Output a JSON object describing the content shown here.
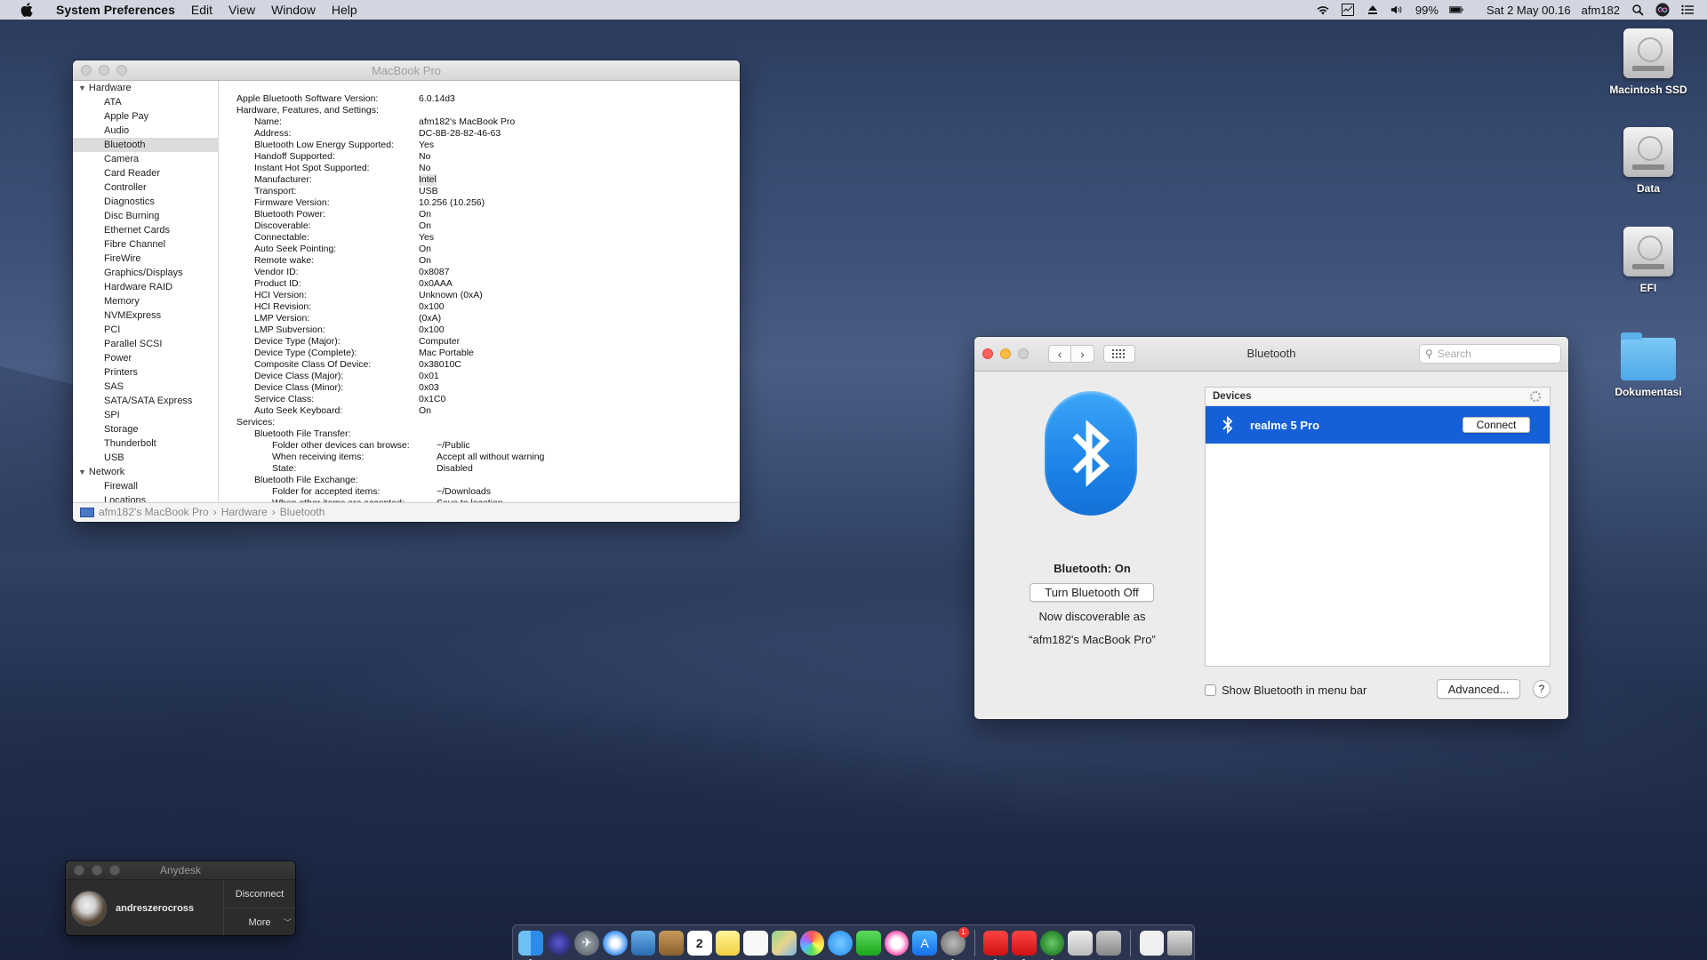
{
  "menubar": {
    "app_name": "System Preferences",
    "menus": [
      "Edit",
      "View",
      "Window",
      "Help"
    ],
    "battery": "99%",
    "datetime": "Sat 2 May  00.16",
    "user": "afm182"
  },
  "sysinfo": {
    "title": "MacBook Pro",
    "sidebar": {
      "hardware_label": "Hardware",
      "hardware_items": [
        "ATA",
        "Apple Pay",
        "Audio",
        "Bluetooth",
        "Camera",
        "Card Reader",
        "Controller",
        "Diagnostics",
        "Disc Burning",
        "Ethernet Cards",
        "Fibre Channel",
        "FireWire",
        "Graphics/Displays",
        "Hardware RAID",
        "Memory",
        "NVMExpress",
        "PCI",
        "Parallel SCSI",
        "Power",
        "Printers",
        "SAS",
        "SATA/SATA Express",
        "SPI",
        "Storage",
        "Thunderbolt",
        "USB"
      ],
      "network_label": "Network",
      "network_items": [
        "Firewall",
        "Locations"
      ]
    },
    "rows": [
      {
        "level": 0,
        "k": "Apple Bluetooth Software Version:",
        "v": "6.0.14d3"
      },
      {
        "level": 0,
        "k": "Hardware, Features, and Settings:",
        "v": ""
      },
      {
        "level": 1,
        "k": "Name:",
        "v": "afm182's MacBook Pro"
      },
      {
        "level": 1,
        "k": "Address:",
        "v": "DC-8B-28-82-46-63"
      },
      {
        "level": 1,
        "k": "Bluetooth Low Energy Supported:",
        "v": "Yes"
      },
      {
        "level": 1,
        "k": "Handoff Supported:",
        "v": "No"
      },
      {
        "level": 1,
        "k": "Instant Hot Spot Supported:",
        "v": "No"
      },
      {
        "level": 1,
        "k": "Manufacturer:",
        "v": "Intel"
      },
      {
        "level": 1,
        "k": "Transport:",
        "v": "USB"
      },
      {
        "level": 1,
        "k": "Firmware Version:",
        "v": "10.256 (10.256)"
      },
      {
        "level": 1,
        "k": "Bluetooth Power:",
        "v": "On"
      },
      {
        "level": 1,
        "k": "Discoverable:",
        "v": "On"
      },
      {
        "level": 1,
        "k": "Connectable:",
        "v": "Yes"
      },
      {
        "level": 1,
        "k": "Auto Seek Pointing:",
        "v": "On"
      },
      {
        "level": 1,
        "k": "Remote wake:",
        "v": "On"
      },
      {
        "level": 1,
        "k": "Vendor ID:",
        "v": "0x8087"
      },
      {
        "level": 1,
        "k": "Product ID:",
        "v": "0x0AAA"
      },
      {
        "level": 1,
        "k": "HCI Version:",
        "v": "Unknown (0xA)"
      },
      {
        "level": 1,
        "k": "HCI Revision:",
        "v": "0x100"
      },
      {
        "level": 1,
        "k": "LMP Version:",
        "v": " (0xA)"
      },
      {
        "level": 1,
        "k": "LMP Subversion:",
        "v": "0x100"
      },
      {
        "level": 1,
        "k": "Device Type (Major):",
        "v": "Computer"
      },
      {
        "level": 1,
        "k": "Device Type (Complete):",
        "v": "Mac Portable"
      },
      {
        "level": 1,
        "k": "Composite Class Of Device:",
        "v": "0x38010C"
      },
      {
        "level": 1,
        "k": "Device Class (Major):",
        "v": "0x01"
      },
      {
        "level": 1,
        "k": "Device Class (Minor):",
        "v": "0x03"
      },
      {
        "level": 1,
        "k": "Service Class:",
        "v": "0x1C0"
      },
      {
        "level": 1,
        "k": "Auto Seek Keyboard:",
        "v": "On"
      },
      {
        "level": 0,
        "k": "Services:",
        "v": ""
      },
      {
        "level": 1,
        "k": "Bluetooth File Transfer:",
        "v": ""
      },
      {
        "level": 2,
        "k": "Folder other devices can browse:",
        "v": "~/Public"
      },
      {
        "level": 2,
        "k": "When receiving items:",
        "v": "Accept all without warning"
      },
      {
        "level": 2,
        "k": "State:",
        "v": "Disabled"
      },
      {
        "level": 1,
        "k": "Bluetooth File Exchange:",
        "v": ""
      },
      {
        "level": 2,
        "k": "Folder for accepted items:",
        "v": "~/Downloads"
      },
      {
        "level": 2,
        "k": "When other items are accepted:",
        "v": "Save to location"
      }
    ],
    "breadcrumb": [
      "afm182's MacBook Pro",
      "Hardware",
      "Bluetooth"
    ],
    "breadcrumb_sep": "›"
  },
  "bluetooth": {
    "title": "Bluetooth",
    "search_placeholder": "Search",
    "status": "Bluetooth: On",
    "toggle_label": "Turn Bluetooth Off",
    "discoverable_line1": "Now discoverable as",
    "discoverable_line2": "“afm182's MacBook Pro”",
    "devices_header": "Devices",
    "devices": [
      {
        "name": "realme 5 Pro",
        "action": "Connect"
      }
    ],
    "show_in_menubar_label": "Show Bluetooth in menu bar",
    "advanced_label": "Advanced...",
    "help_label": "?"
  },
  "anydesk": {
    "title": "Anydesk",
    "user": "andreszerocross",
    "disconnect_label": "Disconnect",
    "more_label": "More"
  },
  "desktop": {
    "icons": [
      "Macintosh SSD",
      "Data",
      "EFI",
      "Dokumentasi"
    ]
  },
  "dock": {
    "calendar_day": "2",
    "badge_count": "1"
  }
}
